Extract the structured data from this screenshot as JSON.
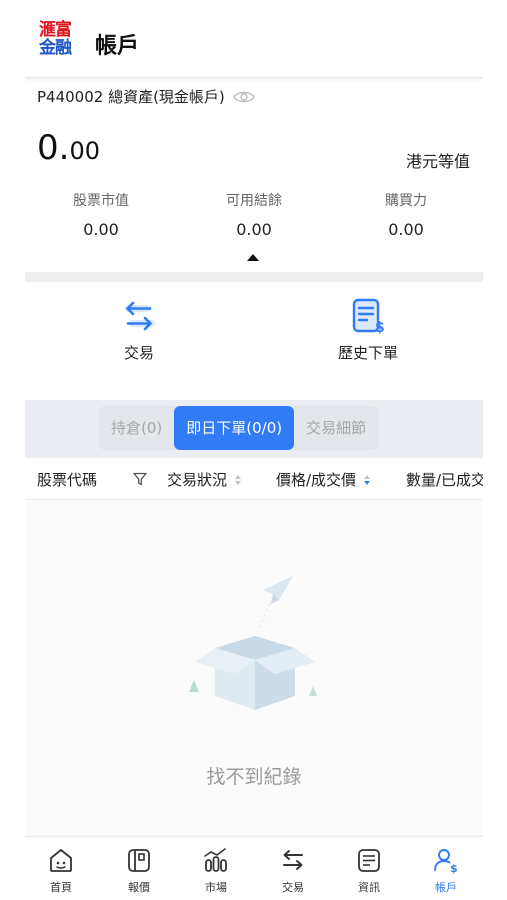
{
  "header": {
    "logo_line1": "滙富",
    "logo_line2": "金融",
    "title": "帳戶"
  },
  "account": {
    "label": "P440002 總資產(現金帳戶)",
    "total_int": "0.",
    "total_dec": "00",
    "currency_note": "港元等值",
    "stats": [
      {
        "label": "股票市值",
        "value": "0.00"
      },
      {
        "label": "可用結餘",
        "value": "0.00"
      },
      {
        "label": "購買力",
        "value": "0.00"
      }
    ]
  },
  "actions": [
    {
      "label": "交易",
      "icon": "trade-arrows-icon"
    },
    {
      "label": "歷史下單",
      "icon": "order-history-icon"
    }
  ],
  "tabs": [
    {
      "label": "持倉(0)",
      "active": false
    },
    {
      "label": "即日下單(0/0)",
      "active": true
    },
    {
      "label": "交易細節",
      "active": false
    }
  ],
  "columns": {
    "code": "股票代碼",
    "status": "交易狀況",
    "price": "價格/成交價",
    "qty": "數量/已成交"
  },
  "empty": {
    "message": "找不到紀錄"
  },
  "bottom_nav": [
    {
      "label": "首頁",
      "icon": "home-icon"
    },
    {
      "label": "報價",
      "icon": "quote-icon"
    },
    {
      "label": "市場",
      "icon": "market-icon"
    },
    {
      "label": "交易",
      "icon": "trade-icon"
    },
    {
      "label": "資訊",
      "icon": "news-icon"
    },
    {
      "label": "帳戶",
      "icon": "account-icon"
    }
  ],
  "colors": {
    "accent": "#2f7cf6",
    "brand_red": "#e0141e",
    "brand_blue": "#1f56c7"
  }
}
